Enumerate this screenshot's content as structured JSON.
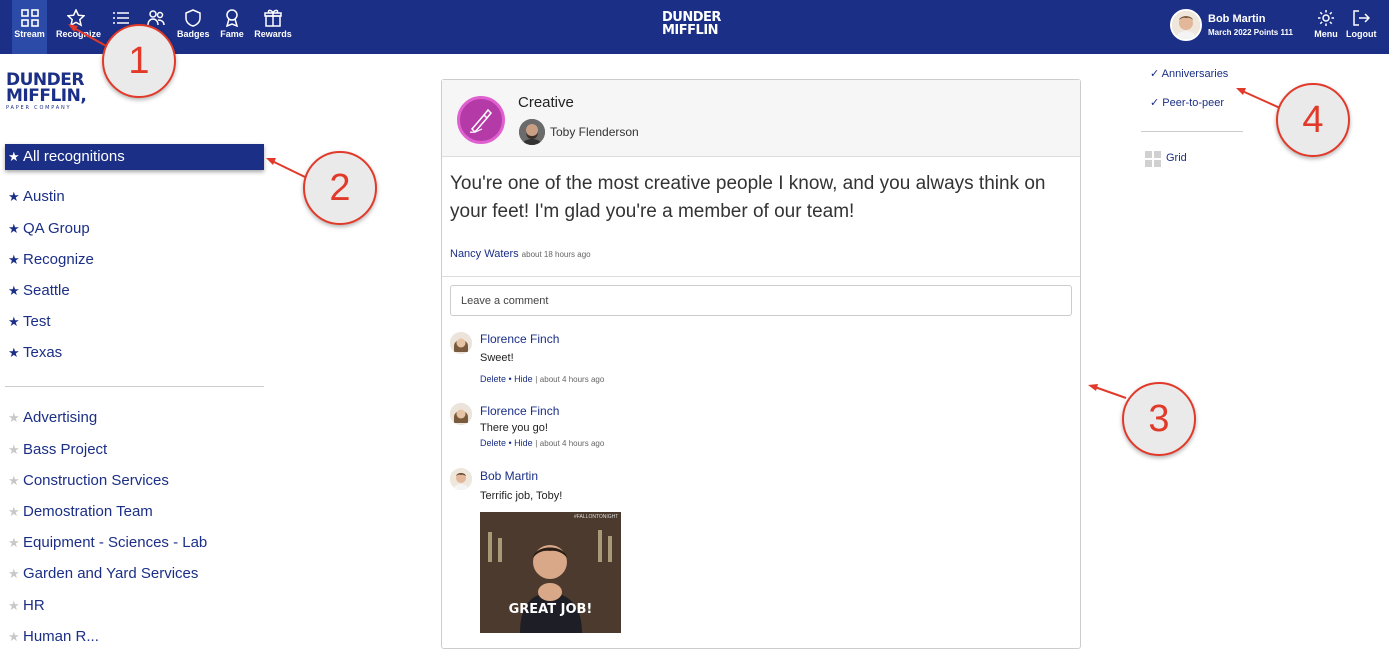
{
  "topnav": {
    "items": [
      {
        "label": "Stream",
        "icon": "stream-icon"
      },
      {
        "label": "Recognize",
        "icon": "star-icon"
      },
      {
        "label": "",
        "icon": "list-icon"
      },
      {
        "label": "",
        "icon": "users-icon"
      },
      {
        "label": "Badges",
        "icon": "badge-icon"
      },
      {
        "label": "Fame",
        "icon": "ribbon-icon"
      },
      {
        "label": "Rewards",
        "icon": "gift-icon"
      }
    ],
    "brand": {
      "line1": "DUNDER",
      "line2": "MIFFLIN"
    },
    "user": {
      "name": "Bob Martin",
      "sub": "March 2022 Points 111"
    },
    "menu_label": "Menu",
    "logout_label": "Logout"
  },
  "sidebar": {
    "logo": {
      "line1": "DUNDER",
      "line2": "MIFFLIN,",
      "tag": "PAPER COMPANY"
    },
    "selected": "All recognitions",
    "groups_primary": [
      "Austin",
      "QA Group",
      "Recognize",
      "Seattle",
      "Test",
      "Texas"
    ],
    "groups_secondary": [
      "Advertising",
      "Bass Project",
      "Construction Services",
      "Demostration Team",
      "Equipment - Sciences - Lab",
      "Garden and Yard Services",
      "HR",
      "Human R..."
    ],
    "star_active_color": "#1b2f86",
    "star_inactive_color": "#c8c8c8"
  },
  "post": {
    "badge": "Creative",
    "recipient": "Toby Flenderson",
    "message": "You're one of the most creative people I know, and you always think on your feet! I'm glad you're a member of our team!",
    "sender": "Nancy Waters",
    "sender_time": "about 18 hours ago",
    "comment_placeholder": "Leave a comment",
    "comments": [
      {
        "author": "Florence Finch",
        "text": "Sweet!",
        "delete": "Delete",
        "hide": "Hide",
        "time": "about 4 hours ago"
      },
      {
        "author": "Florence Finch",
        "text": "There you go!",
        "delete": "Delete",
        "hide": "Hide",
        "time": "about 4 hours ago"
      },
      {
        "author": "Bob Martin",
        "text": "Terrific job, Toby!"
      }
    ],
    "gif_caption": "GREAT JOB!",
    "gif_watermark": "#FALLONTONIGHT"
  },
  "filters": {
    "items": [
      "Anniversaries",
      "Peer-to-peer"
    ],
    "check": "✓",
    "grid_label": "Grid"
  },
  "callouts": [
    "1",
    "2",
    "3",
    "4"
  ],
  "colors": {
    "primary": "#1b2f86",
    "callout": "#e23a2a"
  }
}
